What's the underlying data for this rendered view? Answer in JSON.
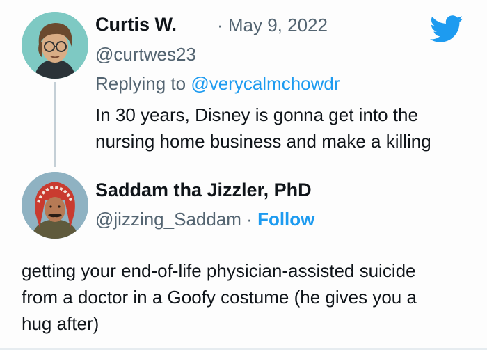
{
  "tweet1": {
    "name": "Curtis W.",
    "date": "· May 9, 2022",
    "handle": "@curtwes23",
    "replying_prefix": "Replying to ",
    "replying_to": "@verycalmchowdr",
    "text_line1": "In 30 years, Disney is gonna get into the",
    "text_line2": "nursing home business and make a killing"
  },
  "tweet2": {
    "name": "Saddam tha Jizzler, PhD",
    "handle": "@jizzing_Saddam",
    "separator": " · ",
    "follow_label": "Follow",
    "text_line1": "getting your end-of-life physician-assisted suicide",
    "text_line2": "from a doctor in a Goofy costume (he gives you a",
    "text_line3": "hug after)"
  },
  "icons": {
    "brand": "twitter-bird-icon"
  },
  "colors": {
    "accent": "#1d9bf0",
    "secondary_text": "#536471",
    "thread_line": "#c4cfd6"
  }
}
